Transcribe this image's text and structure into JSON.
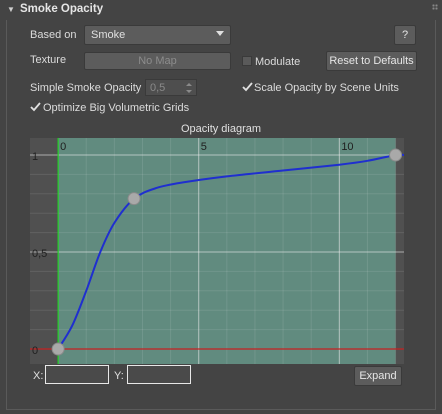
{
  "rollout": {
    "title": "Smoke Opacity"
  },
  "based_on": {
    "label": "Based on",
    "value": "Smoke",
    "help_label": "?"
  },
  "texture": {
    "label": "Texture",
    "map_label": "No Map"
  },
  "modulate": {
    "label": "Modulate",
    "checked": false
  },
  "reset_button": {
    "label": "Reset to Defaults"
  },
  "simple_opacity": {
    "label": "Simple Smoke Opacity",
    "value": "0,5"
  },
  "scale_opacity": {
    "label": "Scale Opacity by Scene Units",
    "checked": true
  },
  "optimize": {
    "label": "Optimize Big Volumetric Grids",
    "checked": true
  },
  "diagram": {
    "title": "Opacity diagram",
    "x_ticks": [
      "0",
      "5",
      "10"
    ],
    "y_ticks": [
      "1",
      "0,5",
      "0"
    ],
    "coord_x_label": "X:",
    "coord_y_label": "Y:",
    "coord_x_value": "",
    "coord_y_value": "",
    "expand_label": "Expand"
  },
  "colors": {
    "plot_bg": "#618b7f",
    "outside_bg": "#505050",
    "curve": "#1f2fcf",
    "x_axis_line": "#c62020",
    "y_axis_line": "#22d022",
    "point": "#a9a9a9"
  },
  "chart_data": {
    "type": "line",
    "title": "Opacity diagram",
    "xlabel": "",
    "ylabel": "",
    "xlim": [
      -1,
      12.3
    ],
    "ylim": [
      0,
      1
    ],
    "range_end_x": 12,
    "control_points": [
      {
        "x": 0,
        "y": 0.0
      },
      {
        "x": 2.7,
        "y": 0.775
      },
      {
        "x": 12.0,
        "y": 1.0
      }
    ],
    "series": [
      {
        "values": [
          [
            0,
            0.0
          ],
          [
            0.5,
            0.12
          ],
          [
            1,
            0.3
          ],
          [
            1.5,
            0.5
          ],
          [
            2,
            0.65
          ],
          [
            2.7,
            0.775
          ],
          [
            3.5,
            0.83
          ],
          [
            4.5,
            0.86
          ],
          [
            6,
            0.89
          ],
          [
            8,
            0.92
          ],
          [
            10,
            0.95
          ],
          [
            11,
            0.97
          ],
          [
            12,
            1.0
          ],
          [
            12.3,
            1.0
          ]
        ]
      }
    ]
  }
}
